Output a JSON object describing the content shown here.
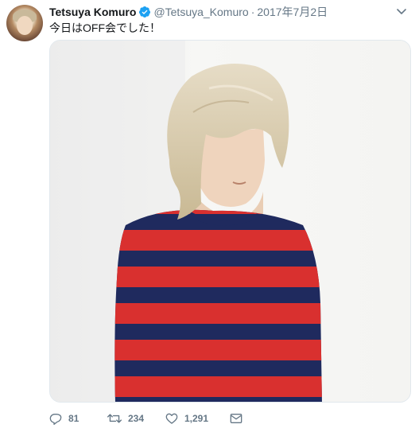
{
  "tweet": {
    "display_name": "Tetsuya Komuro",
    "handle": "@Tetsuya_Komuro",
    "separator": "·",
    "date": "2017年7月2日",
    "text": "今日はOFF会でした！",
    "verified": true
  },
  "actions": {
    "reply_count": "81",
    "retweet_count": "234",
    "like_count": "1,291"
  },
  "icons": {
    "reply": "reply-icon",
    "retweet": "retweet-icon",
    "like": "heart-icon",
    "dm": "envelope-icon",
    "more": "chevron-down-icon",
    "verified": "verified-badge-icon"
  },
  "colors": {
    "text_primary": "#14171a",
    "text_secondary": "#657786",
    "verified_blue": "#1da1f2",
    "border": "#e1e8ed",
    "sweater_red": "#d9302f",
    "sweater_navy": "#1f2a5e",
    "hair": "#d8cbb0"
  }
}
